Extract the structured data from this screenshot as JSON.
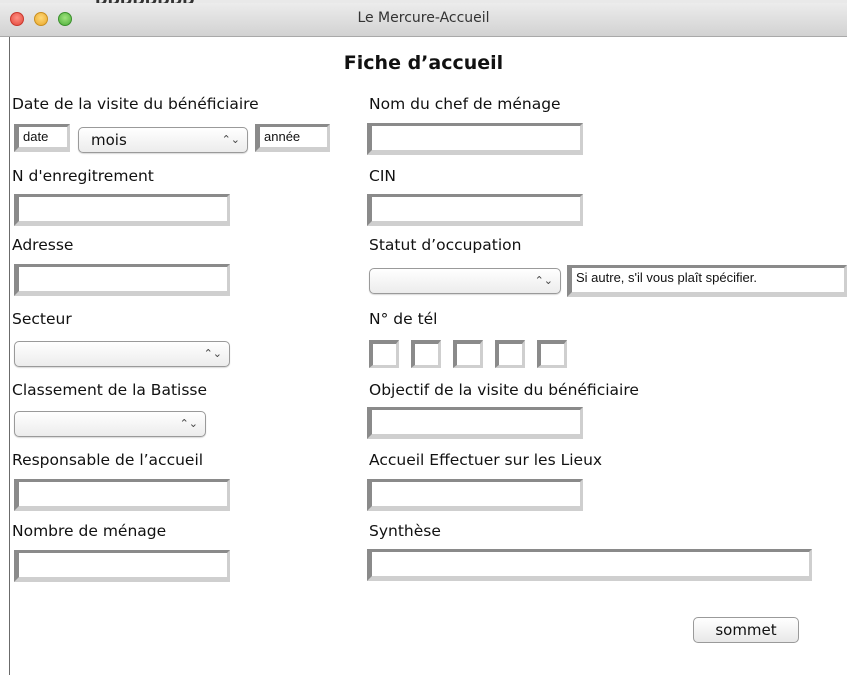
{
  "window": {
    "title": "Le Mercure-Accueil",
    "behind_text": "DDDDDDDD"
  },
  "form": {
    "heading": "Fiche d’accueil",
    "visit_date": {
      "label": "Date de la visite du bénéficiaire",
      "day_value": "date",
      "month_value": "mois",
      "year_value": "année"
    },
    "head_of_household": {
      "label": "Nom du chef de ménage",
      "value": ""
    },
    "registration_number": {
      "label": "N d'enregitrement",
      "value": ""
    },
    "cin": {
      "label": "CIN",
      "value": ""
    },
    "address": {
      "label": "Adresse",
      "value": ""
    },
    "occupancy_status": {
      "label": "Statut d’occupation",
      "value": "",
      "other_value": "Si autre, s'il vous plaît spécifier."
    },
    "sector": {
      "label": "Secteur",
      "value": ""
    },
    "phone": {
      "label": "N° de tél",
      "segments": [
        "",
        "",
        "",
        "",
        ""
      ]
    },
    "building_class": {
      "label": "Classement de la Batisse",
      "value": ""
    },
    "visit_objective": {
      "label": "Objectif de la visite du bénéficiaire",
      "value": ""
    },
    "reception_officer": {
      "label": "Responsable de l’accueil",
      "value": ""
    },
    "onsite_reception": {
      "label": "Accueil Effectuer sur les Lieux",
      "value": ""
    },
    "household_count": {
      "label": "Nombre de ménage",
      "value": ""
    },
    "summary": {
      "label": "Synthèse",
      "value": ""
    },
    "submit_label": "sommet"
  },
  "icons": {
    "select_arrows": "⌃⌄"
  },
  "colors": {
    "titlebar_top": "#ececec",
    "titlebar_bottom": "#d2d2d2",
    "close": "#e2463a",
    "minimize": "#e9a72a",
    "maximize": "#4cae3a",
    "field_border_dark": "#8a8a8a",
    "field_border_light": "#cfcfcf"
  }
}
